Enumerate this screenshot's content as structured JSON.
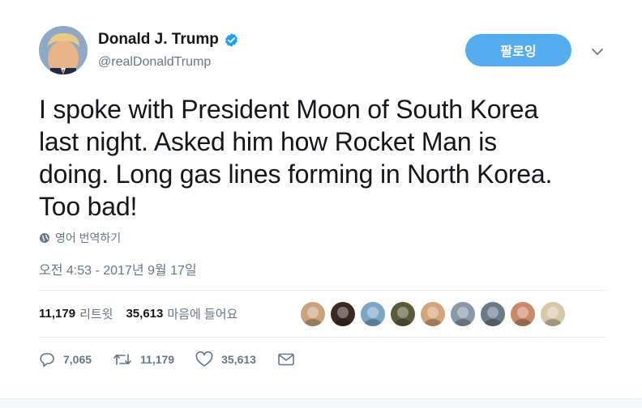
{
  "author": {
    "display_name": "Donald J. Trump",
    "handle": "@realDonaldTrump",
    "verified": true
  },
  "follow_button": {
    "label": "팔로잉"
  },
  "tweet": {
    "text_lines": [
      "I spoke with President Moon of South Korea",
      "last night. Asked him how Rocket Man is",
      "doing. Long gas lines forming in North Korea.",
      "Too bad!"
    ]
  },
  "translate_link": {
    "label": "영어 번역하기",
    "icon": "globe-icon"
  },
  "timestamp": "오전 4:53 - 2017년 9월 17일",
  "stats": {
    "retweets": {
      "count": "11,179",
      "label": "리트윗"
    },
    "likes": {
      "count": "35,613",
      "label": "마음에 들어요"
    }
  },
  "likers": [
    {
      "name": "liker-1",
      "color": "#c9a37c"
    },
    {
      "name": "liker-2",
      "color": "#3a2a22"
    },
    {
      "name": "liker-3",
      "color": "#7aa6c6"
    },
    {
      "name": "liker-4",
      "color": "#5b5a3a"
    },
    {
      "name": "liker-5",
      "color": "#d4a57a"
    },
    {
      "name": "liker-6",
      "color": "#8a98a8"
    },
    {
      "name": "liker-7",
      "color": "#6b7a86"
    },
    {
      "name": "liker-8",
      "color": "#c98a6a"
    },
    {
      "name": "liker-9",
      "color": "#d8c8a8"
    }
  ],
  "actions": {
    "reply": {
      "icon": "reply-icon",
      "count": "7,065"
    },
    "retweet": {
      "icon": "retweet-icon",
      "count": "11,179"
    },
    "like": {
      "icon": "heart-icon",
      "count": "35,613"
    },
    "message": {
      "icon": "envelope-icon"
    }
  },
  "colors": {
    "accent": "#55acee",
    "verified_badge": "#1da1f2",
    "secondary_text": "#657786"
  }
}
